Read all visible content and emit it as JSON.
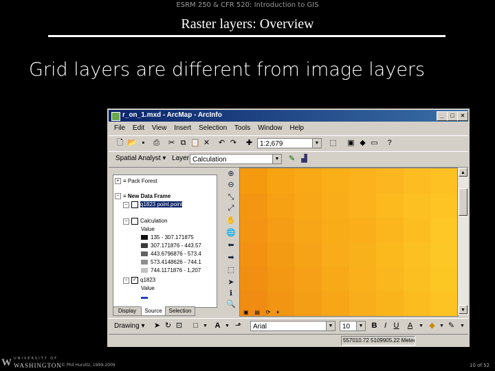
{
  "slide": {
    "course_header": "ESRM 250 & CFR 520: Introduction to GIS",
    "title": "Raster layers: Overview",
    "heading": "Grid layers are different from image layers",
    "footer": {
      "university_line": "UNIVERSITY OF",
      "washington_line": "WASHINGTON",
      "copyright": "© Phil Hurvitz, 1999-2009",
      "slide_number": "10 of 52"
    }
  },
  "arcmap": {
    "window_title": "r_on_1.mxd - ArcMap - ArcInfo",
    "menu": [
      "File",
      "Edit",
      "View",
      "Insert",
      "Selection",
      "Tools",
      "Window",
      "Help"
    ],
    "scale_value": "1:2,679",
    "spatial_analyst_label": "Spatial Analyst ▾",
    "layer_label": "Layer:",
    "layer_value": "Calculation",
    "toc": {
      "items": [
        {
          "label": "Pack Forest"
        },
        {
          "label": "New Data Frame"
        },
        {
          "label": "q1823 point.point"
        },
        {
          "label": "Calculation"
        },
        {
          "label": "Value"
        },
        {
          "label": "135 - 307.171875"
        },
        {
          "label": "307.171876 - 443.57"
        },
        {
          "label": "443.6796876 - 573.4"
        },
        {
          "label": "573.4148626 - 744.1"
        },
        {
          "label": "744.1171876 - 1,207"
        },
        {
          "label": "q1823"
        },
        {
          "label": "Value"
        }
      ],
      "swatch_colors": [
        "#111111",
        "#3a3a3a",
        "#626262",
        "#8e8e8e",
        "#c2c2c2"
      ],
      "tabs": [
        "Display",
        "Source",
        "Selection"
      ]
    },
    "drawing_label": "Drawing ▾",
    "font_name": "Arial",
    "font_size": "10",
    "status_coords": "557010.72 5109905.22 Meters",
    "raster_colors": [
      "#f59a0f",
      "#f7a312",
      "#f9a816",
      "#faaf18",
      "#fbb21c",
      "#fcb61f",
      "#fdbd22",
      "#fec124",
      "#f49612",
      "#f6a014",
      "#f8a816",
      "#f9ad18",
      "#fbb21c",
      "#fcba1f",
      "#fdc022",
      "#fec424",
      "#f39412",
      "#f59d14",
      "#f7a617",
      "#f8ac18",
      "#faaf1a",
      "#fbb61d",
      "#fcbd20",
      "#fec726",
      "#f29112",
      "#f49b14",
      "#f6a317",
      "#f8ac19",
      "#f9b11b",
      "#fbb91e",
      "#fcc022",
      "#fdc825",
      "#f18f12",
      "#f39813",
      "#f5a016",
      "#f7a918",
      "#f9b01b",
      "#fab71e",
      "#fcbf21",
      "#fdc723",
      "#f08c11",
      "#f29513",
      "#f49e15",
      "#f6a617",
      "#f8ae1a",
      "#f9b41c",
      "#fbbc20",
      "#fcc322"
    ]
  }
}
